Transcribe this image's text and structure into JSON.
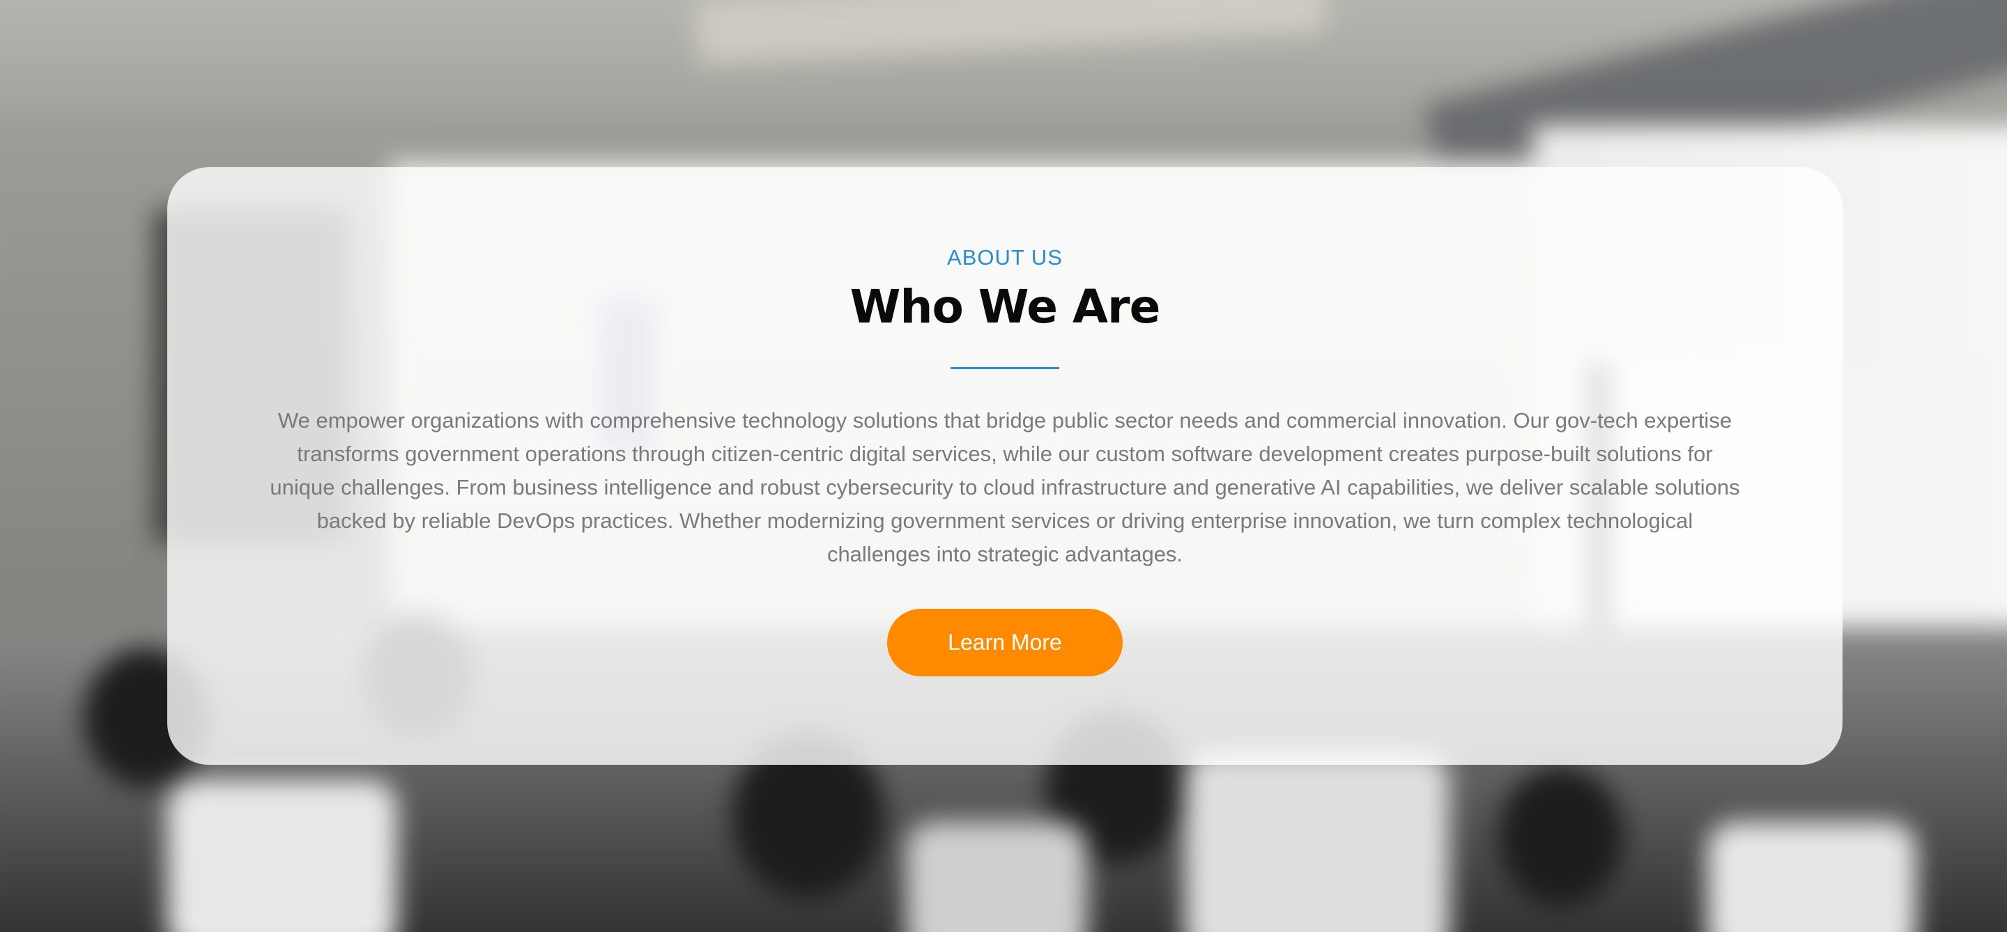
{
  "about": {
    "eyebrow": "ABOUT US",
    "title": "Who We Are",
    "description": "We empower organizations with comprehensive technology solutions that bridge public sector needs and commercial innovation. Our gov-tech expertise transforms government operations through citizen-centric digital services, while our custom software development creates purpose-built solutions for unique challenges. From business intelligence and robust cybersecurity to cloud infrastructure and generative AI capabilities, we deliver scalable solutions backed by reliable DevOps practices. Whether modernizing government services or driving enterprise innovation, we turn complex technological challenges into strategic advantages.",
    "cta_label": "Learn More"
  },
  "colors": {
    "accent": "#2a8bd0",
    "button": "#ff8a00",
    "title": "#0a0a0a",
    "body_text": "#7a7a7a"
  }
}
